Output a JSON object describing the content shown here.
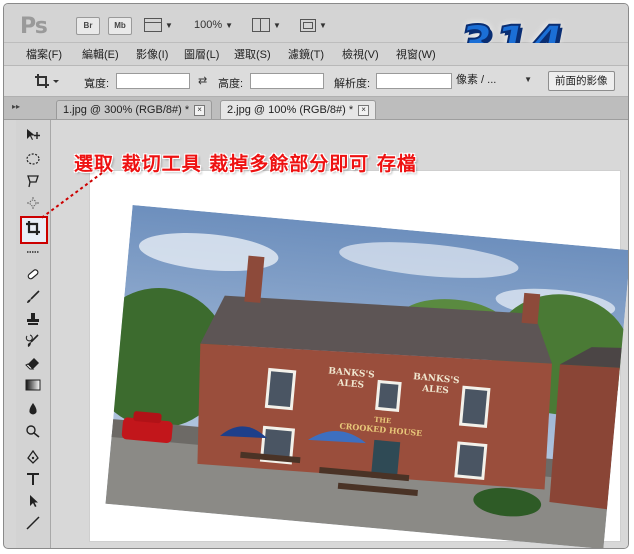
{
  "app": {
    "logo": "Ps",
    "buttons": [
      "Br",
      "Mb"
    ],
    "zoom": "100%"
  },
  "menu": [
    "檔案(F)",
    "編輯(E)",
    "影像(I)",
    "圖層(L)",
    "選取(S)",
    "濾鏡(T)",
    "檢視(V)",
    "視窗(W)"
  ],
  "options": {
    "width_label": "寬度:",
    "height_label": "高度:",
    "resolution_label": "解析度:",
    "unit_select": "像素 / ...",
    "front_image_button": "前面的影像"
  },
  "tabs": [
    {
      "label": "1.jpg @ 300% (RGB/8#) *",
      "active": false
    },
    {
      "label": "2.jpg @ 100% (RGB/8#) *",
      "active": true
    }
  ],
  "annotation": "選取 裁切工具 裁掉多餘部分即可 存檔",
  "watermark": "314",
  "photo_sign_text": [
    "BANKS'S",
    "ALES",
    "BANKS'S",
    "ALES",
    "THE",
    "CROOKED HOUSE"
  ],
  "tools": [
    "move-tool",
    "marquee-tool",
    "lasso-tool",
    "quick-selection-tool",
    "crop-tool",
    "eyedropper-tool",
    "healing-brush-tool",
    "brush-tool",
    "clone-stamp-tool",
    "history-brush-tool",
    "eraser-tool",
    "gradient-tool",
    "blur-tool",
    "dodge-tool",
    "pen-tool",
    "type-tool",
    "path-selection-tool",
    "line-tool"
  ],
  "colors": {
    "annotation_red": "#ee1111",
    "highlight_red": "#cc0000",
    "logo_blue": "#1b6fd6"
  }
}
